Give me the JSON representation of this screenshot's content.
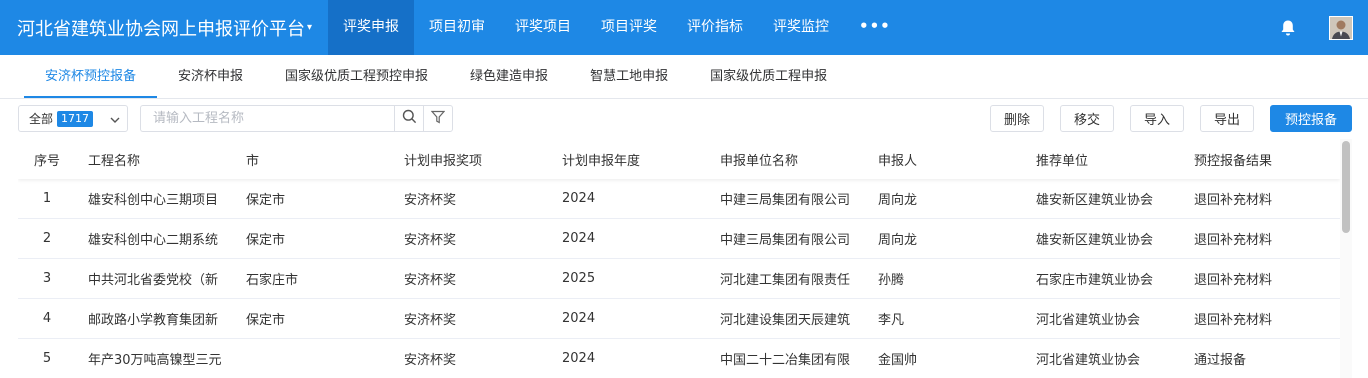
{
  "header": {
    "brand": "河北省建筑业协会网上申报评价平台",
    "nav": [
      {
        "label": "评奖申报",
        "active": true
      },
      {
        "label": "项目初审",
        "active": false
      },
      {
        "label": "评奖项目",
        "active": false
      },
      {
        "label": "项目评奖",
        "active": false
      },
      {
        "label": "评价指标",
        "active": false
      },
      {
        "label": "评奖监控",
        "active": false
      }
    ],
    "more": "•••",
    "icons": {
      "notification": "bell-icon",
      "user": "avatar"
    }
  },
  "subtabs": [
    {
      "label": "安济杯预控报备",
      "active": true
    },
    {
      "label": "安济杯申报",
      "active": false
    },
    {
      "label": "国家级优质工程预控申报",
      "active": false
    },
    {
      "label": "绿色建造申报",
      "active": false
    },
    {
      "label": "智慧工地申报",
      "active": false
    },
    {
      "label": "国家级优质工程申报",
      "active": false
    }
  ],
  "toolbar": {
    "filter_label": "全部",
    "filter_count": "1717",
    "search_placeholder": "请输入工程名称",
    "buttons": {
      "delete": "删除",
      "transfer": "移交",
      "import": "导入",
      "export": "导出",
      "prereport": "预控报备"
    }
  },
  "table": {
    "columns": [
      "序号",
      "工程名称",
      "市",
      "计划申报奖项",
      "计划申报年度",
      "申报单位名称",
      "申报人",
      "推荐单位",
      "预控报备结果"
    ],
    "rows": [
      [
        "1",
        "雄安科创中心三期项目",
        "保定市",
        "安济杯奖",
        "2024",
        "中建三局集团有限公司",
        "周向龙",
        "雄安新区建筑业协会",
        "退回补充材料"
      ],
      [
        "2",
        "雄安科创中心二期系统",
        "保定市",
        "安济杯奖",
        "2024",
        "中建三局集团有限公司",
        "周向龙",
        "雄安新区建筑业协会",
        "退回补充材料"
      ],
      [
        "3",
        "中共河北省委党校（新",
        "石家庄市",
        "安济杯奖",
        "2025",
        "河北建工集团有限责任",
        "孙腾",
        "石家庄市建筑业协会",
        "退回补充材料"
      ],
      [
        "4",
        "邮政路小学教育集团新",
        "保定市",
        "安济杯奖",
        "2024",
        "河北建设集团天辰建筑",
        "李凡",
        "河北省建筑业协会",
        "退回补充材料"
      ],
      [
        "5",
        "年产30万吨高镍型三元",
        "",
        "安济杯奖",
        "2024",
        "中国二十二冶集团有限",
        "金国帅",
        "河北省建筑业协会",
        "通过报备"
      ]
    ]
  },
  "colors": {
    "primary": "#1e88e5",
    "nav_active": "#1570c8"
  }
}
